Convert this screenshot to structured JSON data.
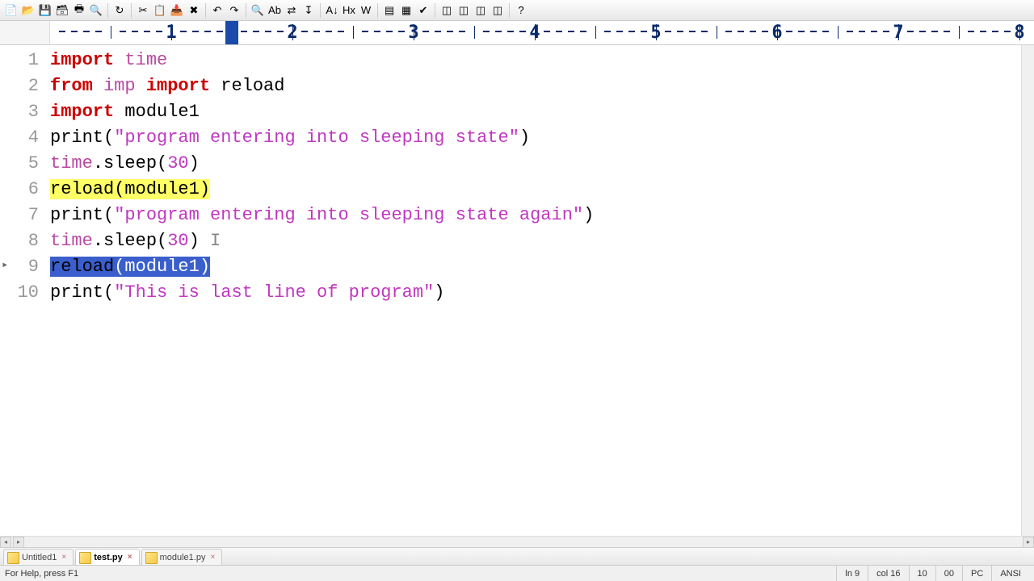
{
  "toolbar": {
    "icons": [
      "new-file",
      "open-file",
      "save",
      "save-all",
      "print",
      "print-preview",
      "separator",
      "reload",
      "separator",
      "cut",
      "copy",
      "paste",
      "delete",
      "separator",
      "undo",
      "redo",
      "separator",
      "find",
      "find-text",
      "replace",
      "goto",
      "separator",
      "font-smaller",
      "font-larger",
      "word-wrap",
      "separator",
      "toggle-panel",
      "toggle-sidebar",
      "check",
      "separator",
      "window1",
      "window2",
      "window3",
      "window4",
      "separator",
      "help"
    ]
  },
  "ruler": {
    "marks": [
      1,
      2,
      3,
      4,
      5,
      6,
      7,
      8
    ],
    "cursor_col": 1.5
  },
  "code": {
    "lines": [
      {
        "n": 1,
        "tokens": [
          {
            "t": "import ",
            "c": "kw"
          },
          {
            "t": "time",
            "c": "mod"
          }
        ]
      },
      {
        "n": 2,
        "tokens": [
          {
            "t": "from ",
            "c": "kw"
          },
          {
            "t": "imp ",
            "c": "mod"
          },
          {
            "t": "import ",
            "c": "kw"
          },
          {
            "t": "reload",
            "c": "id"
          }
        ]
      },
      {
        "n": 3,
        "tokens": [
          {
            "t": "import ",
            "c": "kw"
          },
          {
            "t": "module1",
            "c": "id"
          }
        ]
      },
      {
        "n": 4,
        "tokens": [
          {
            "t": "print",
            "c": "fn"
          },
          {
            "t": "(",
            "c": "pn"
          },
          {
            "t": "\"program entering into sleeping state\"",
            "c": "str"
          },
          {
            "t": ")",
            "c": "pn"
          }
        ]
      },
      {
        "n": 5,
        "tokens": [
          {
            "t": "time",
            "c": "mod"
          },
          {
            "t": ".",
            "c": "pn"
          },
          {
            "t": "sleep",
            "c": "fn"
          },
          {
            "t": "(",
            "c": "pn"
          },
          {
            "t": "30",
            "c": "num"
          },
          {
            "t": ")",
            "c": "pn"
          }
        ]
      },
      {
        "n": 6,
        "hl": "yellow",
        "tokens": [
          {
            "t": "reload",
            "c": "fn"
          },
          {
            "t": "(",
            "c": "pn"
          },
          {
            "t": "module1",
            "c": "id"
          },
          {
            "t": ")",
            "c": "pn"
          }
        ]
      },
      {
        "n": 7,
        "tokens": [
          {
            "t": "print",
            "c": "fn"
          },
          {
            "t": "(",
            "c": "pn"
          },
          {
            "t": "\"program entering into sleeping state again\"",
            "c": "str"
          },
          {
            "t": ")",
            "c": "pn"
          }
        ]
      },
      {
        "n": 8,
        "tokens": [
          {
            "t": "time",
            "c": "mod"
          },
          {
            "t": ".",
            "c": "pn"
          },
          {
            "t": "sleep",
            "c": "fn"
          },
          {
            "t": "(",
            "c": "pn"
          },
          {
            "t": "30",
            "c": "num"
          },
          {
            "t": ")",
            "c": "pn"
          }
        ],
        "caret_after": true
      },
      {
        "n": 9,
        "hl": "sel",
        "active": true,
        "tokens": [
          {
            "t": "reload",
            "c": "fn"
          },
          {
            "t": "(",
            "c": "pn"
          },
          {
            "t": "module1",
            "c": "id"
          },
          {
            "t": ")",
            "c": "pn"
          }
        ]
      },
      {
        "n": 10,
        "tokens": [
          {
            "t": "print",
            "c": "fn"
          },
          {
            "t": "(",
            "c": "pn"
          },
          {
            "t": "\"This is last line of program\"",
            "c": "str"
          },
          {
            "t": ")",
            "c": "pn"
          }
        ]
      }
    ]
  },
  "tabs": [
    {
      "label": "Untitled1",
      "active": false
    },
    {
      "label": "test.py",
      "active": true
    },
    {
      "label": "module1.py",
      "active": false
    }
  ],
  "status": {
    "help": "For Help, press F1",
    "line": "ln 9",
    "col": "col 16",
    "sel1": "10",
    "sel2": "00",
    "os": "PC",
    "enc": "ANSI"
  }
}
